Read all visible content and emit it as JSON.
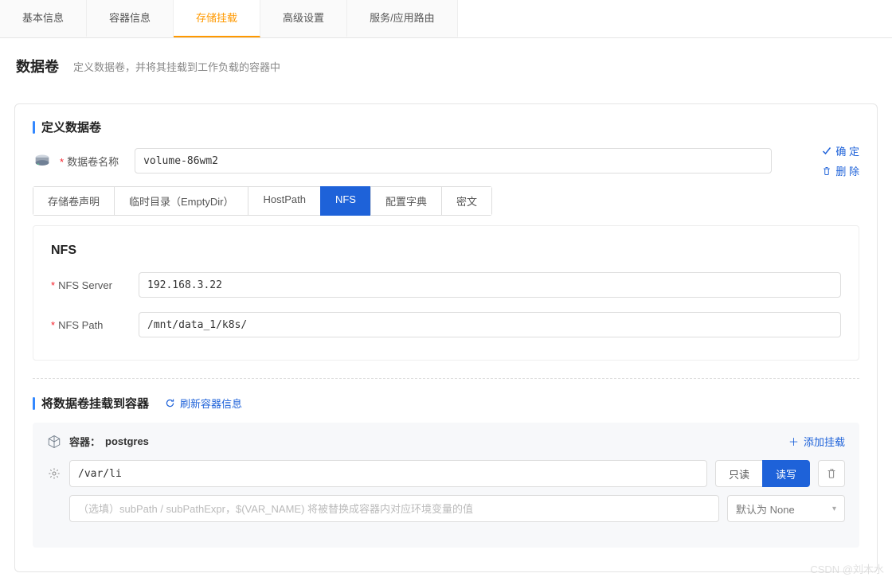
{
  "tabs": {
    "main": [
      "基本信息",
      "容器信息",
      "存储挂载",
      "高级设置",
      "服务/应用路由"
    ],
    "active_index": 2
  },
  "header": {
    "title": "数据卷",
    "desc": "定义数据卷，并将其挂载到工作负载的容器中"
  },
  "define": {
    "title": "定义数据卷",
    "name_label": "数据卷名称",
    "name_value": "volume-86wm2",
    "confirm_label": "确 定",
    "delete_label": "删 除"
  },
  "sub_tabs": {
    "items": [
      "存储卷声明",
      "临时目录（EmptyDir）",
      "HostPath",
      "NFS",
      "配置字典",
      "密文"
    ],
    "active_index": 3
  },
  "nfs": {
    "panel_title": "NFS",
    "server_label": "NFS Server",
    "server_value": "192.168.3.22",
    "path_label": "NFS Path",
    "path_value": "/mnt/data_1/k8s/"
  },
  "mount": {
    "title": "将数据卷挂载到容器",
    "refresh_label": "刷新容器信息",
    "container_prefix": "容器：",
    "container_name": "postgres",
    "add_label": "添加挂载",
    "path_value": "/var/li",
    "read_only_label": "只读",
    "read_write_label": "读写",
    "subpath_placeholder": "（选填）subPath / subPathExpr，$(VAR_NAME) 将被替换成容器内对应环境变量的值",
    "select_value": "默认为 None"
  },
  "watermark": "CSDN @刘木水"
}
